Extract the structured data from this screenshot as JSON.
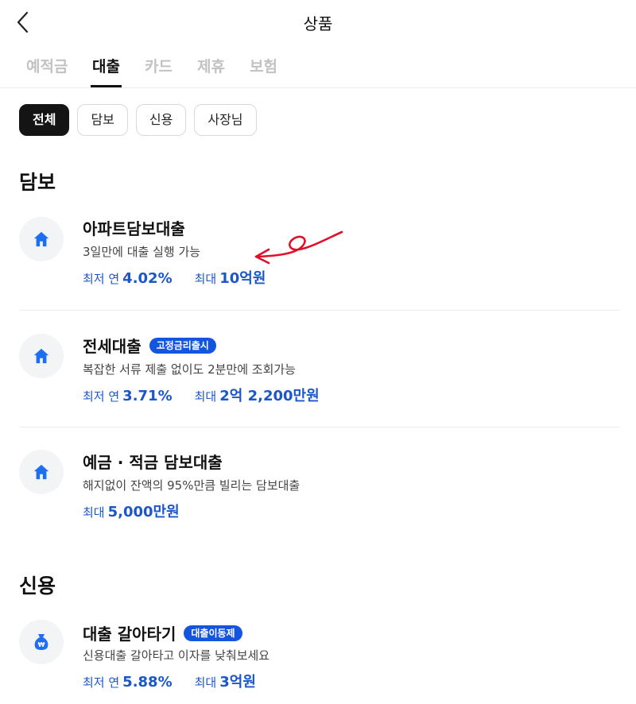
{
  "header": {
    "title": "상품",
    "back_icon": "chevron-left-icon"
  },
  "tabs": [
    {
      "label": "예적금",
      "active": false
    },
    {
      "label": "대출",
      "active": true
    },
    {
      "label": "카드",
      "active": false
    },
    {
      "label": "제휴",
      "active": false
    },
    {
      "label": "보험",
      "active": false
    }
  ],
  "chips": [
    {
      "label": "전체",
      "active": true
    },
    {
      "label": "담보",
      "active": false
    },
    {
      "label": "신용",
      "active": false
    },
    {
      "label": "사장님",
      "active": false
    }
  ],
  "sections": [
    {
      "title": "담보",
      "items": [
        {
          "icon": "house-icon",
          "title": "아파트담보대출",
          "badge": "",
          "desc": "3일만에 대출 실행 가능",
          "rates": [
            {
              "label": "최저 연",
              "value": "4.02%"
            },
            {
              "label": "최대",
              "value": "10억원"
            }
          ]
        },
        {
          "icon": "house-icon",
          "title": "전세대출",
          "badge": "고정금리출시",
          "desc": "복잡한 서류 제출 없이도 2분만에 조회가능",
          "rates": [
            {
              "label": "최저 연",
              "value": "3.71%"
            },
            {
              "label": "최대",
              "value": "2억 2,200만원"
            }
          ]
        },
        {
          "icon": "house-icon",
          "title": "예금 · 적금 담보대출",
          "badge": "",
          "desc": "해지없이 잔액의 95%만큼 빌리는 담보대출",
          "rates": [
            {
              "label": "최대",
              "value": "5,000만원"
            }
          ]
        }
      ]
    },
    {
      "title": "신용",
      "items": [
        {
          "icon": "money-bag-icon",
          "title": "대출 갈아타기",
          "badge": "대출이동제",
          "desc": "신용대출 갈아타고 이자를 낮춰보세요",
          "rates": [
            {
              "label": "최저 연",
              "value": "5.88%"
            },
            {
              "label": "최대",
              "value": "3억원"
            }
          ]
        }
      ]
    }
  ],
  "colors": {
    "accent": "#1b57c9",
    "badge": "#1455e0",
    "icon": "#1b6ff0",
    "annotation": "#e0102a"
  }
}
